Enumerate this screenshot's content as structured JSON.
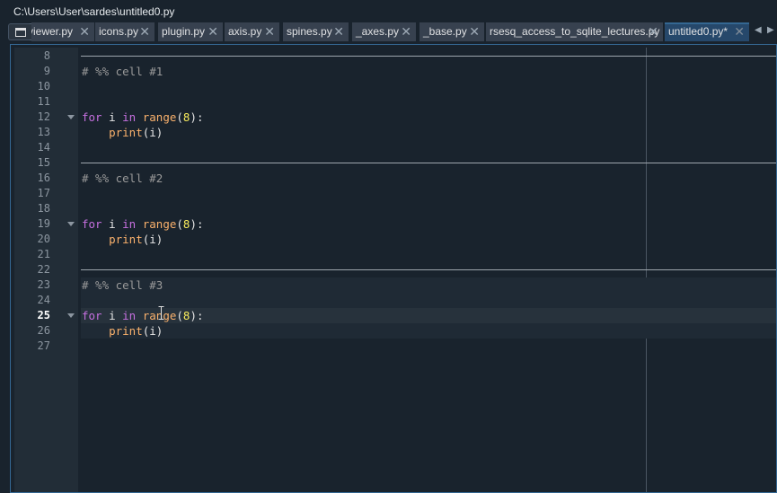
{
  "window": {
    "file_path": "C:\\Users\\User\\sardes\\untitled0.py"
  },
  "tabs": [
    {
      "label": "viewer.py",
      "active": false
    },
    {
      "label": "icons.py",
      "active": false
    },
    {
      "label": "plugin.py",
      "active": false
    },
    {
      "label": "axis.py",
      "active": false
    },
    {
      "label": "spines.py",
      "active": false
    },
    {
      "label": "_axes.py",
      "active": false
    },
    {
      "label": "_base.py",
      "active": false
    },
    {
      "label": "rsesq_access_to_sqlite_lectures.py",
      "active": false
    },
    {
      "label": "untitled0.py*",
      "active": true
    }
  ],
  "tab_close_glyph": "✕",
  "tab_scroll": {
    "left": "◀",
    "right": "▶"
  },
  "editor": {
    "current_line": 25,
    "lines": [
      {
        "n": "8"
      },
      {
        "n": "9",
        "comment": "# %% cell #1"
      },
      {
        "n": "10"
      },
      {
        "n": "11"
      },
      {
        "n": "12",
        "fold": true,
        "kw": "for",
        "t1": " i ",
        "kw2": "in",
        "t2": " ",
        "bi": "range",
        "p1": "(",
        "num": "8",
        "p2": "):"
      },
      {
        "n": "13",
        "indent": "    ",
        "bi": "print",
        "rest": "(i)"
      },
      {
        "n": "14"
      },
      {
        "n": "15"
      },
      {
        "n": "16",
        "comment": "# %% cell #2"
      },
      {
        "n": "17"
      },
      {
        "n": "18"
      },
      {
        "n": "19",
        "fold": true,
        "kw": "for",
        "t1": " i ",
        "kw2": "in",
        "t2": " ",
        "bi": "range",
        "p1": "(",
        "num": "8",
        "p2": "):"
      },
      {
        "n": "20",
        "indent": "    ",
        "bi": "print",
        "rest": "(i)"
      },
      {
        "n": "21"
      },
      {
        "n": "22"
      },
      {
        "n": "23",
        "comment": "# %% cell #3"
      },
      {
        "n": "24"
      },
      {
        "n": "25",
        "fold": true,
        "kw": "for",
        "t1": " i ",
        "kw2": "in",
        "t2": " ",
        "bi": "range",
        "p1": "(",
        "num": "8",
        "p2": "):"
      },
      {
        "n": "26",
        "indent": "    ",
        "bi": "print",
        "rest": "(i)"
      },
      {
        "n": "27"
      }
    ]
  },
  "colors": {
    "background": "#19232d",
    "accent": "#346792",
    "keyword": "#c670e0",
    "builtin": "#fab16c",
    "number": "#faed5c",
    "comment": "#999999"
  }
}
